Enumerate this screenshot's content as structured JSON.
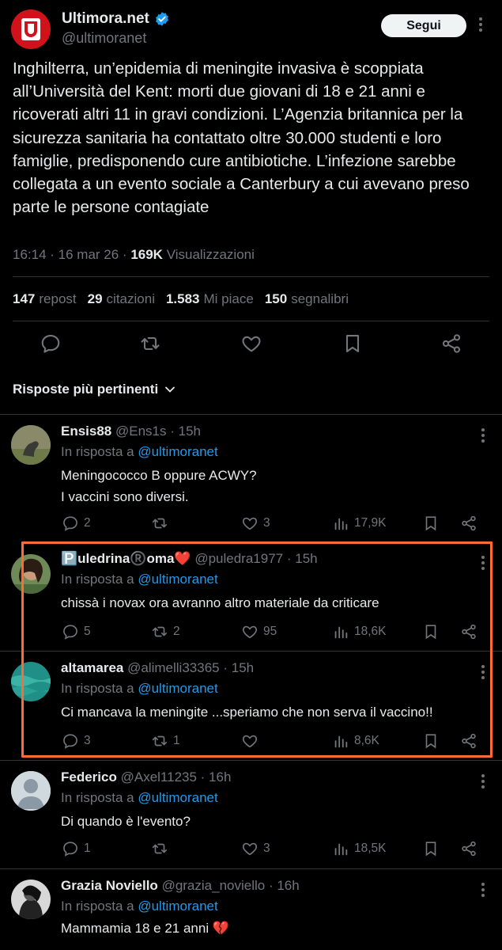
{
  "post": {
    "author_name": "Ultimora.net",
    "author_handle": "@ultimoranet",
    "follow_label": "Segui",
    "text": "Inghilterra, un’epidemia di meningite invasiva è scoppiata all’Università del Kent: morti due giovani di 18 e 21 anni e ricoverati altri 11 in gravi condizioni. L’Agenzia britannica per la sicurezza sanitaria ha contattato oltre 30.000 studenti e loro famiglie, predisponendo cure antibiotiche. L’infezione sarebbe collegata a un evento sociale a Canterbury a cui avevano preso parte le persone contagiate",
    "time": "16:14 · 16 mar 26 · ",
    "views_count": "169K",
    "views_label": "Visualizzazioni",
    "stats": {
      "reposts_count": "147",
      "reposts_label": "repost",
      "quotes_count": "29",
      "quotes_label": "citazioni",
      "likes_count": "1.583",
      "likes_label": "Mi piace",
      "bookmarks_count": "150",
      "bookmarks_label": "segnalibri"
    },
    "brand_color": "#d0121b",
    "accent_color": "#1d9bf0"
  },
  "replies_section": {
    "title": "Risposte più pertinenti"
  },
  "replies": [
    {
      "name": "Ensis88",
      "handle": "@Ens1s",
      "time": "· 15h",
      "reply_prefix": "In risposta a",
      "reply_to": "@ultimoranet",
      "text": "Meningococco B oppure ACWY?\nI vaccini sono diversi.",
      "comments": "2",
      "reposts": "",
      "likes": "3",
      "views": "17,9K"
    },
    {
      "name": "🅿️uledrina®️oma❤️",
      "handle": "@puledra1977",
      "time": "· 15h",
      "reply_prefix": "In risposta a",
      "reply_to": "@ultimoranet",
      "text": "chissà i novax ora avranno altro materiale da criticare",
      "comments": "5",
      "reposts": "2",
      "likes": "95",
      "views": "18,6K"
    },
    {
      "name": "altamarea",
      "handle": "@alimelli33365",
      "time": "· 15h",
      "reply_prefix": "In risposta a",
      "reply_to": "@ultimoranet",
      "text": "Ci mancava la meningite ...speriamo che non serva il vaccino!!",
      "comments": "3",
      "reposts": "1",
      "likes": "",
      "views": "8,6K"
    },
    {
      "name": "Federico",
      "handle": "@Axel11235",
      "time": "· 16h",
      "reply_prefix": "In risposta a",
      "reply_to": "@ultimoranet",
      "text": "Di quando è l'evento?",
      "comments": "1",
      "reposts": "",
      "likes": "3",
      "views": "18,5K"
    },
    {
      "name": "Grazia Noviello",
      "handle": "@grazia_noviello",
      "time": "· 16h",
      "reply_prefix": "In risposta a",
      "reply_to": "@ultimoranet",
      "text": "Mammamia 18 e 21 anni 💔",
      "comments": "",
      "reposts": "",
      "likes": "",
      "views": ""
    }
  ],
  "highlight_color": "#ff6b35"
}
